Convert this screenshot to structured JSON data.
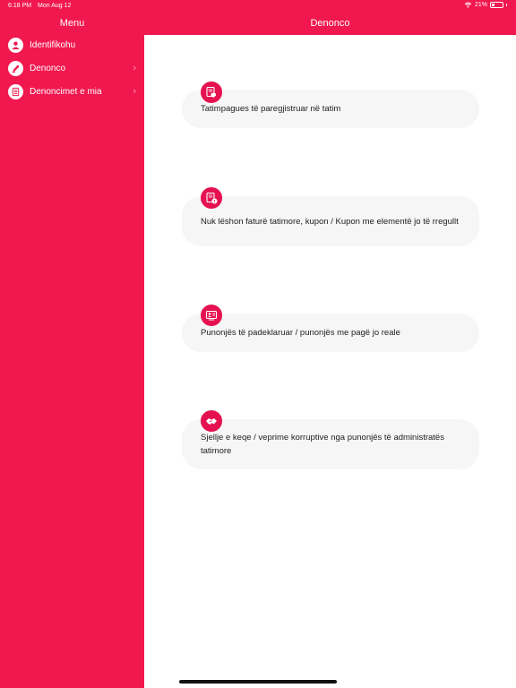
{
  "status_bar": {
    "time": "6:18 PM",
    "date": "Mon Aug 12",
    "battery": "21%"
  },
  "sidebar": {
    "title": "Menu",
    "items": [
      {
        "label": "Identifikohu",
        "icon": "user-icon"
      },
      {
        "label": "Denonco",
        "icon": "report-icon"
      },
      {
        "label": "Denoncimet e mia",
        "icon": "list-icon"
      }
    ]
  },
  "header": {
    "title": "Denonco"
  },
  "cards": [
    {
      "text": "Tatimpagues të paregjistruar në tatim",
      "icon": "unregistered-taxpayer-icon"
    },
    {
      "text": "Nuk lëshon faturë tatimore, kupon / Kupon me elementë jo të rregullt",
      "icon": "invoice-warning-icon"
    },
    {
      "text": "Punonjës të padeklaruar / punonjës me pagë jo reale",
      "icon": "undeclared-workers-icon"
    },
    {
      "text": "Sjellje e keqe / veprime korruptive nga punonjës të administratës tatimore",
      "icon": "corruption-handshake-icon"
    }
  ],
  "colors": {
    "accent": "#f0184e",
    "card_bg": "#f6f6f6",
    "icon_bg": "#e51150"
  }
}
